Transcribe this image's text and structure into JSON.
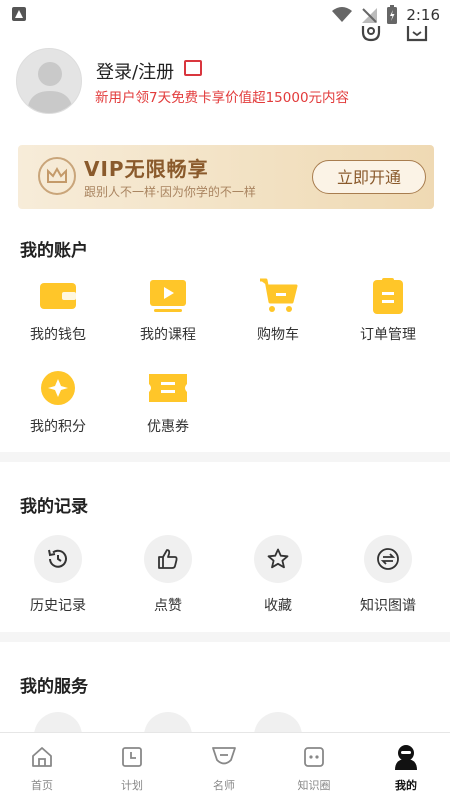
{
  "status_bar": {
    "time": "2:16"
  },
  "profile": {
    "login_label": "登录/注册",
    "promo_text": "新用户领7天免费卡享价值超15000元内容"
  },
  "vip_banner": {
    "title": "VIP无限畅享",
    "subtitle": "跟别人不一样·因为你学的不一样",
    "button_label": "立即开通"
  },
  "account": {
    "title": "我的账户",
    "items": [
      {
        "label": "我的钱包",
        "icon": "wallet-icon"
      },
      {
        "label": "我的课程",
        "icon": "course-icon"
      },
      {
        "label": "购物车",
        "icon": "cart-icon"
      },
      {
        "label": "订单管理",
        "icon": "order-icon"
      },
      {
        "label": "我的积分",
        "icon": "points-icon"
      },
      {
        "label": "优惠券",
        "icon": "coupon-icon"
      }
    ]
  },
  "records": {
    "title": "我的记录",
    "items": [
      {
        "label": "历史记录",
        "icon": "history-icon"
      },
      {
        "label": "点赞",
        "icon": "thumbs-up-icon"
      },
      {
        "label": "收藏",
        "icon": "star-icon"
      },
      {
        "label": "知识图谱",
        "icon": "knowledge-map-icon"
      }
    ]
  },
  "services": {
    "title": "我的服务"
  },
  "tabbar": {
    "tabs": [
      {
        "label": "首页",
        "icon": "home-icon"
      },
      {
        "label": "计划",
        "icon": "plan-icon"
      },
      {
        "label": "名师",
        "icon": "teacher-icon"
      },
      {
        "label": "知识圈",
        "icon": "knowledge-circle-icon"
      },
      {
        "label": "我的",
        "icon": "profile-icon"
      }
    ],
    "active": "我的"
  },
  "colors": {
    "accent_yellow": "#FFC629",
    "promo_red": "#E23B3B",
    "vip_brown": "#8A5A2C"
  }
}
